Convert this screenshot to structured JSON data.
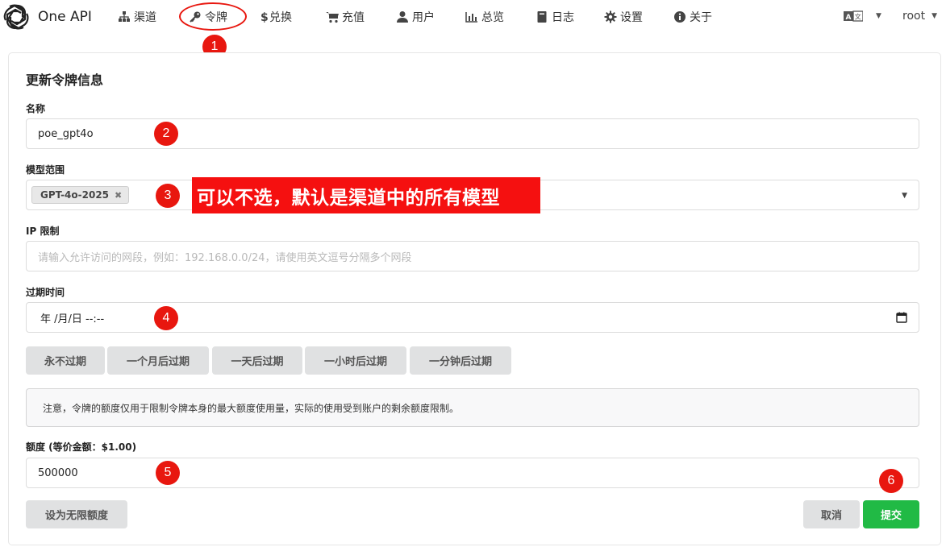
{
  "app": {
    "name": "One API"
  },
  "nav": {
    "items": [
      {
        "label": "渠道",
        "icon": "sitemap-icon"
      },
      {
        "label": "令牌",
        "icon": "key-icon"
      },
      {
        "label": "兑换",
        "icon": "dollar-icon"
      },
      {
        "label": "充值",
        "icon": "cart-icon"
      },
      {
        "label": "用户",
        "icon": "user-icon"
      },
      {
        "label": "总览",
        "icon": "bar-chart-icon"
      },
      {
        "label": "日志",
        "icon": "book-icon"
      },
      {
        "label": "设置",
        "icon": "gear-icon"
      },
      {
        "label": "关于",
        "icon": "info-icon"
      }
    ],
    "language_icon": "translate-icon",
    "user": "root"
  },
  "form": {
    "title": "更新令牌信息",
    "name": {
      "label": "名称",
      "value": "poe_gpt4o"
    },
    "models": {
      "label": "模型范围",
      "selected": [
        "GPT-4o-2025"
      ]
    },
    "ip": {
      "label": "IP 限制",
      "placeholder": "请输入允许访问的网段，例如：192.168.0.0/24，请使用英文逗号分隔多个网段"
    },
    "expiry": {
      "label": "过期时间",
      "value": "年 /月/日 --:--"
    },
    "expiry_buttons": [
      "永不过期",
      "一个月后过期",
      "一天后过期",
      "一小时后过期",
      "一分钟后过期"
    ],
    "notice": "注意，令牌的额度仅用于限制令牌本身的最大额度使用量，实际的使用受到账户的剩余额度限制。",
    "quota": {
      "label": "额度 (等价金额：$1.00)",
      "value": "500000"
    },
    "unlimited_button": "设为无限额度",
    "cancel_button": "取消",
    "submit_button": "提交"
  },
  "annotations": {
    "numbers": [
      "1",
      "2",
      "3",
      "4",
      "5",
      "6"
    ],
    "banner": "可以不选，默认是渠道中的所有模型"
  },
  "colors": {
    "annotation_red": "#e8170f",
    "submit_green": "#21ba45",
    "gray_button": "#e0e1e2"
  }
}
